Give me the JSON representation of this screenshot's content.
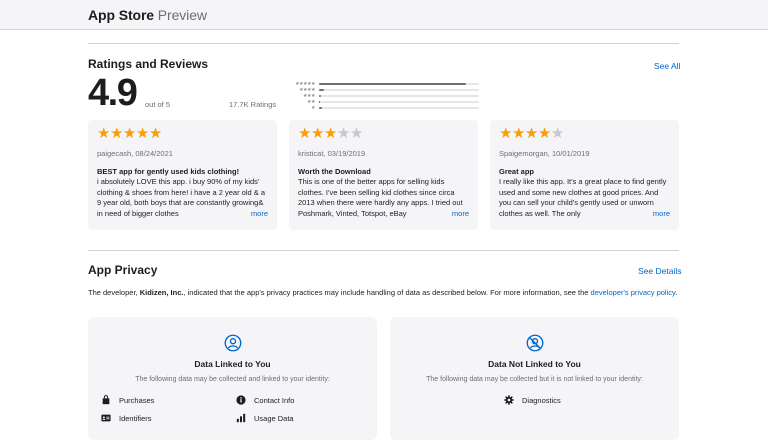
{
  "header": {
    "brand_bold": "App Store",
    "brand_light": "Preview"
  },
  "ratings": {
    "title": "Ratings and Reviews",
    "see_all": "See All",
    "average": "4.9",
    "out_of": "out of 5",
    "count": "17.7K Ratings",
    "histogram": [
      {
        "stars": "★★★★★",
        "fraction": 0.92
      },
      {
        "stars": "★★★★",
        "fraction": 0.03
      },
      {
        "stars": "★★★",
        "fraction": 0.01
      },
      {
        "stars": "★★",
        "fraction": 0.005
      },
      {
        "stars": "★",
        "fraction": 0.02
      }
    ]
  },
  "reviews": [
    {
      "rating": 5,
      "author": "paigecash",
      "date": "08/24/2021",
      "title": "BEST app for gently used kids clothing!",
      "body": "i absolutely LOVE this app. i buy 90% of my kids' clothing & shoes from here! i have a 2 year old & a 9 year old, both boys that are constantly growing& in need of bigger clothes",
      "more": "more"
    },
    {
      "rating": 3,
      "author": "kristicat",
      "date": "03/19/2019",
      "title": "Worth the Download",
      "body": "This is one of the better apps for selling kids clothes. I've been selling kid clothes since circa 2013 when there were hardly any apps. I tried out Poshmark, Vinted, Totspot, eBay",
      "more": "more"
    },
    {
      "rating": 4,
      "author": "Spaigemorgan",
      "date": "10/01/2019",
      "title": "Great app",
      "body": "I really like this app. It's a great place to find gently used and some new clothes at good prices. And you can sell your child's gently used or unworn clothes as well. The only",
      "more": "more"
    }
  ],
  "privacy": {
    "title": "App Privacy",
    "see_details": "See Details",
    "desc_prefix": "The developer, ",
    "developer": "Kidizen, Inc.",
    "desc_suffix": ", indicated that the app's privacy practices may include handling of data as described below. For more information, see the ",
    "policy_link": "developer's privacy policy",
    "desc_end": ".",
    "cards": [
      {
        "title": "Data Linked to You",
        "subtitle": "The following data may be collected and linked to your identity:",
        "icon": "person-circle-icon",
        "items": [
          {
            "label": "Purchases",
            "icon": "shopping-bag-icon"
          },
          {
            "label": "Contact Info",
            "icon": "info-circle-icon"
          },
          {
            "label": "Identifiers",
            "icon": "id-card-icon"
          },
          {
            "label": "Usage Data",
            "icon": "bar-chart-icon"
          }
        ]
      },
      {
        "title": "Data Not Linked to You",
        "subtitle": "The following data may be collected but it is not linked to your identity:",
        "icon": "person-crossed-icon",
        "items": [
          {
            "label": "Diagnostics",
            "icon": "gear-icon"
          }
        ]
      }
    ]
  },
  "colors": {
    "star": "#f99e0a",
    "link": "#0066cc",
    "card_bg": "#f5f5f7"
  }
}
